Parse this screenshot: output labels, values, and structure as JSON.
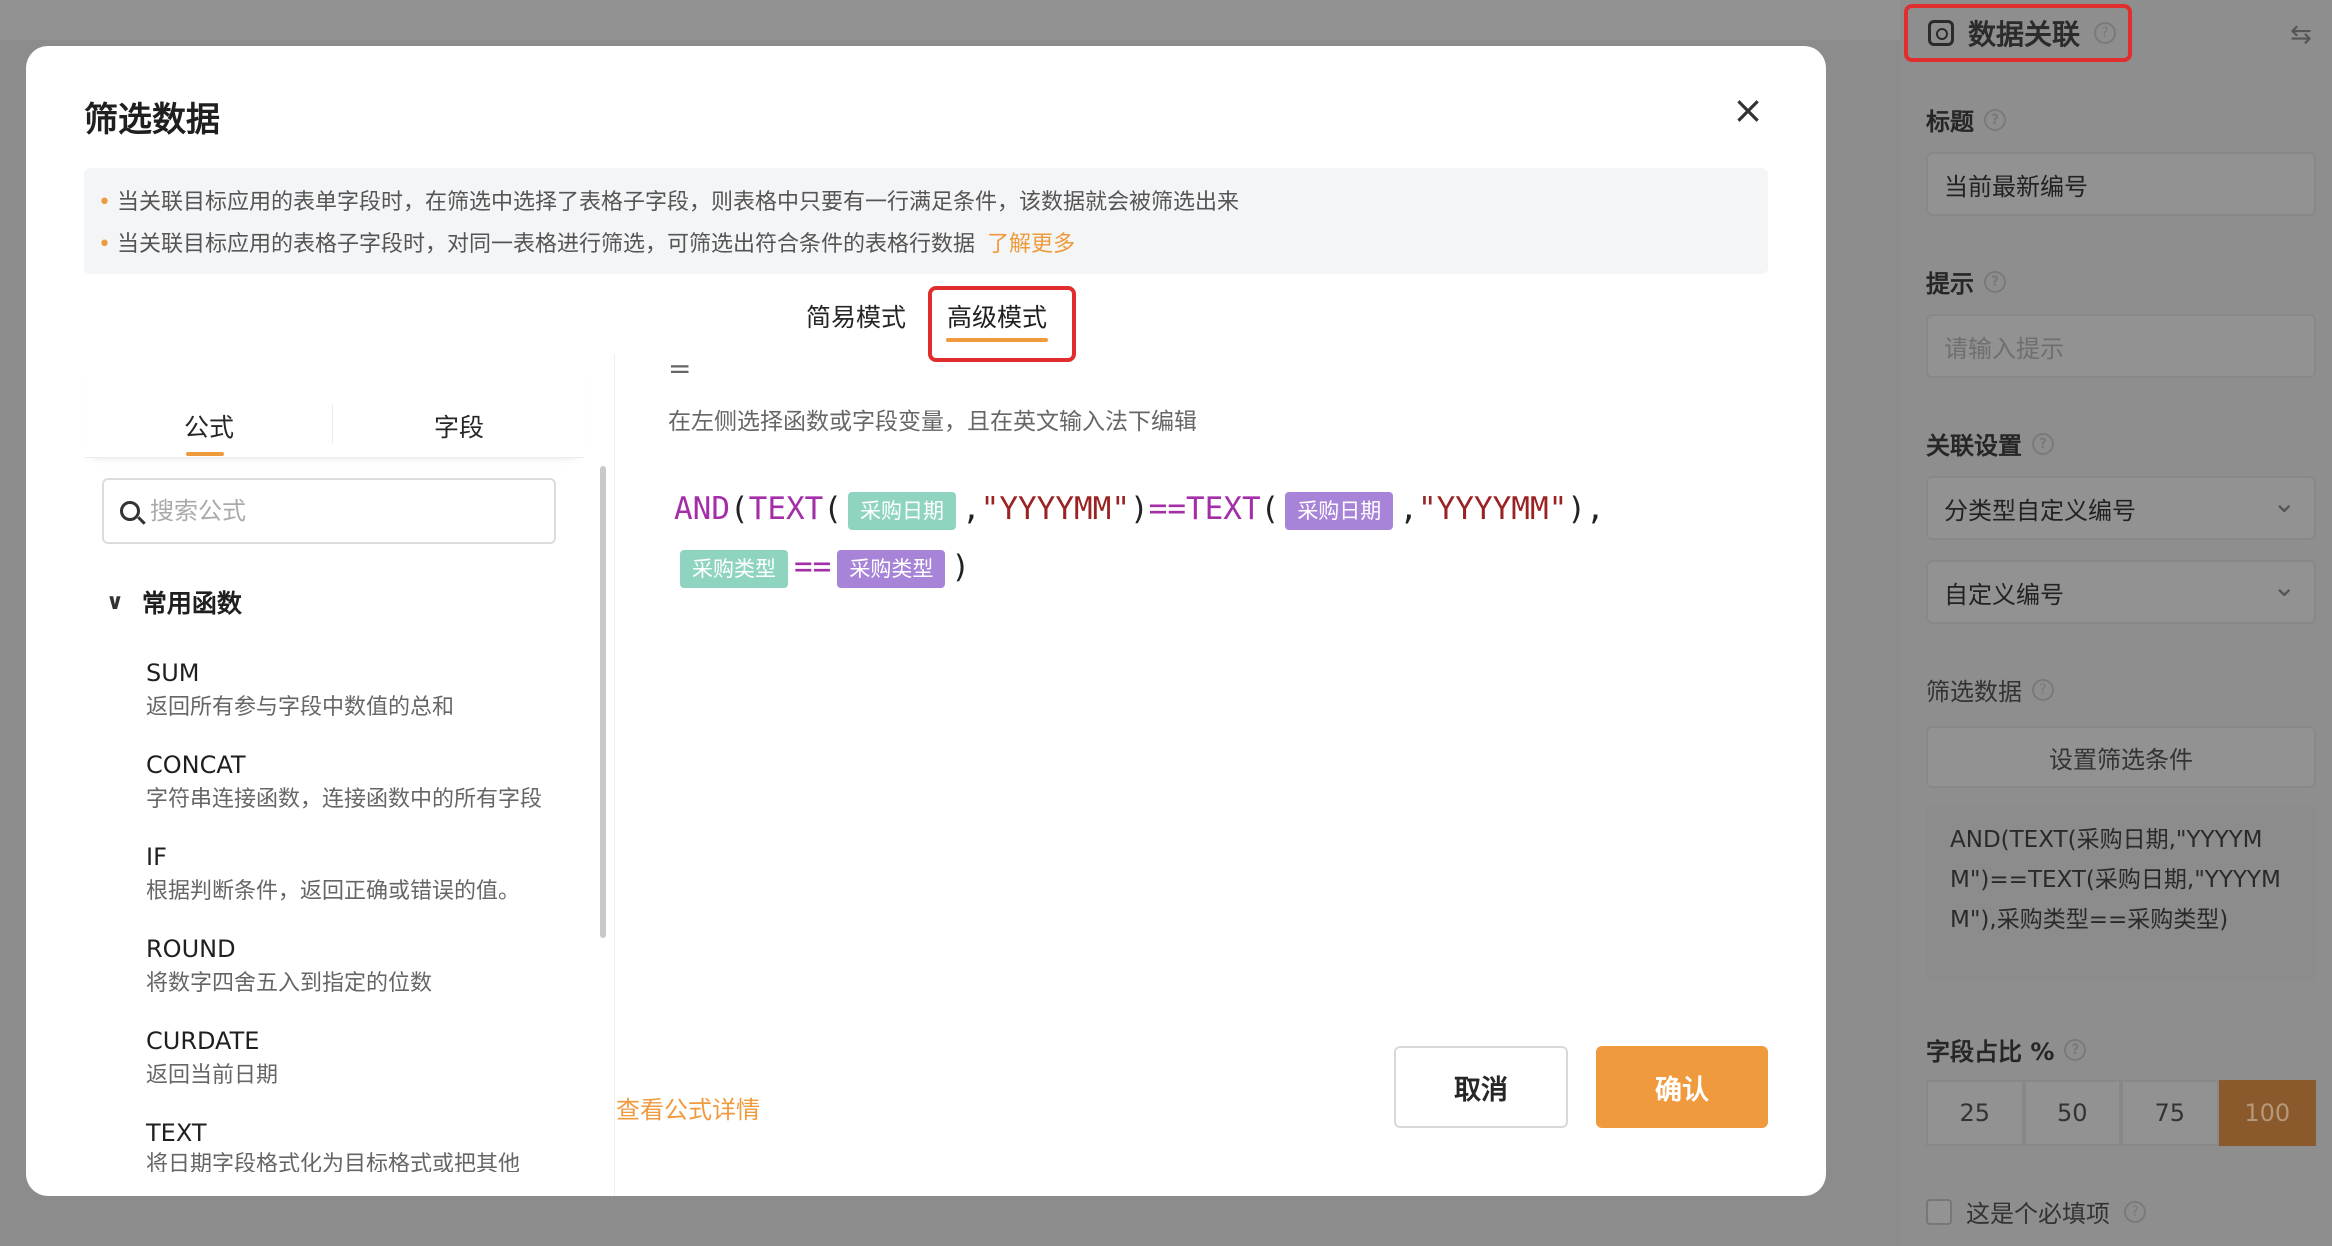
{
  "right_panel": {
    "header_title": "数据关联",
    "title_label": "标题",
    "title_value": "当前最新编号",
    "hint_label": "提示",
    "hint_placeholder": "请输入提示",
    "relation_label": "关联设置",
    "relation_select_1": "分类型自定义编号",
    "relation_select_2": "自定义编号",
    "filter_label": "筛选数据",
    "filter_button": "设置筛选条件",
    "filter_formula": "AND(TEXT(采购日期,\"YYYYMM\")==TEXT(采购日期,\"YYYYMM\"),采购类型==采购类型)",
    "ratio_label": "字段占比 %",
    "ratio_options": [
      "25",
      "50",
      "75",
      "100"
    ],
    "required_label": "这是个必填项"
  },
  "modal": {
    "title": "筛选数据",
    "notice_1": "当关联目标应用的表单字段时，在筛选中选择了表格子字段，则表格中只要有一行满足条件，该数据就会被筛选出来",
    "notice_2": "当关联目标应用的表格子字段时，对同一表格进行筛选，可筛选出符合条件的表格行数据",
    "notice_link": "了解更多",
    "mode_simple": "简易模式",
    "mode_advanced": "高级模式",
    "tab_formula": "公式",
    "tab_field": "字段",
    "search_placeholder": "搜索公式",
    "group_title": "常用函数",
    "functions": [
      {
        "name": "SUM",
        "desc": "返回所有参与字段中数值的总和"
      },
      {
        "name": "CONCAT",
        "desc": "字符串连接函数，连接函数中的所有字段"
      },
      {
        "name": "IF",
        "desc": "根据判断条件，返回正确或错误的值。"
      },
      {
        "name": "ROUND",
        "desc": "将数字四舍五入到指定的位数"
      },
      {
        "name": "CURDATE",
        "desc": "返回当前日期"
      },
      {
        "name": "TEXT",
        "desc": "将日期字段格式化为目标格式或把其他"
      }
    ],
    "eq_sign": "=",
    "editor_hint": "在左侧选择函数或字段变量，且在英文输入法下编辑",
    "code": {
      "and": "AND",
      "text": "TEXT",
      "lp": "(",
      "rp": ")",
      "comma": ",",
      "fmt": "\"YYYYMM\"",
      "eqeq": "==",
      "chip_date": "采购日期",
      "chip_type": "采购类型"
    },
    "detail_link": "查看公式详情",
    "cancel": "取消",
    "confirm": "确认"
  }
}
